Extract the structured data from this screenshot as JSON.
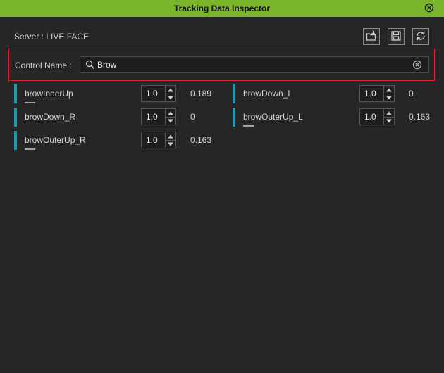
{
  "window": {
    "title": "Tracking Data Inspector"
  },
  "server": {
    "label": "Server : LIVE FACE"
  },
  "toolbar": {
    "icons": [
      "load-folder-icon",
      "save-icon",
      "refresh-icon"
    ]
  },
  "filter": {
    "label": "Control Name :",
    "value": "Brow"
  },
  "colors": {
    "accent": "#7ab52c",
    "highlight": "#e0242b",
    "bar": "#1a9bb3"
  },
  "controls": [
    {
      "name": "browInnerUp",
      "strength": "1.0",
      "value": "0.189",
      "level": 0.189
    },
    {
      "name": "browDown_L",
      "strength": "1.0",
      "value": "0",
      "level": 0
    },
    {
      "name": "browDown_R",
      "strength": "1.0",
      "value": "0",
      "level": 0
    },
    {
      "name": "browOuterUp_L",
      "strength": "1.0",
      "value": "0.163",
      "level": 0.163
    },
    {
      "name": "browOuterUp_R",
      "strength": "1.0",
      "value": "0.163",
      "level": 0.163
    }
  ]
}
